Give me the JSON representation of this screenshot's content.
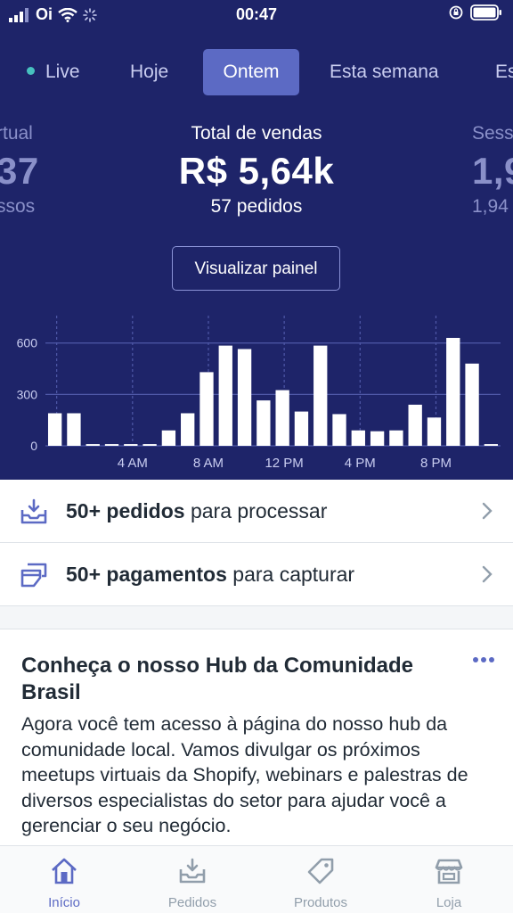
{
  "status_bar": {
    "carrier": "Oi",
    "time": "00:47"
  },
  "tabs": [
    {
      "label": "Live"
    },
    {
      "label": "Hoje"
    },
    {
      "label": "Ontem",
      "active": true
    },
    {
      "label": "Esta semana"
    },
    {
      "label": "Es"
    }
  ],
  "metrics": {
    "left": {
      "label": "rtual",
      "value": "37",
      "sub": "ssos"
    },
    "center": {
      "label": "Total de vendas",
      "value": "R$ 5,64k",
      "sub": "57 pedidos"
    },
    "right": {
      "label": "Sess",
      "value": "1,9",
      "sub": "1,94"
    }
  },
  "panel_button": "Visualizar painel",
  "chart_data": {
    "type": "bar",
    "y_ticks": [
      "0",
      "300",
      "600"
    ],
    "ylim": [
      0,
      760
    ],
    "x_tick_labels": [
      "4 AM",
      "8 AM",
      "12 PM",
      "4 PM",
      "8 PM"
    ],
    "x_tick_hours": [
      4,
      8,
      12,
      16,
      20
    ],
    "categories": [
      0,
      1,
      2,
      3,
      4,
      5,
      6,
      7,
      8,
      9,
      10,
      11,
      12,
      13,
      14,
      15,
      16,
      17,
      18,
      19,
      20,
      21,
      22,
      23
    ],
    "values": [
      190,
      190,
      10,
      10,
      10,
      10,
      90,
      190,
      430,
      585,
      565,
      265,
      325,
      200,
      585,
      185,
      90,
      85,
      90,
      240,
      165,
      630,
      480,
      10
    ],
    "colors": {
      "bar": "#ffffff",
      "grid": "#4f58a8",
      "tick": "#c9cdf0"
    }
  },
  "list": [
    {
      "bold": "50+ pedidos",
      "rest": " para processar",
      "icon": "inbox-download-icon"
    },
    {
      "bold": "50+ pagamentos",
      "rest": " para capturar",
      "icon": "payments-icon"
    }
  ],
  "card": {
    "title": "Conheça o nosso Hub da Comunidade Brasil",
    "body": "Agora você tem acesso à página do nosso hub da comunidade local. Vamos divulgar os próximos meetups virtuais da Shopify, webinars e palestras de diversos especialistas do setor para ajudar você a gerenciar o seu negócio."
  },
  "bottom_nav": [
    {
      "label": "Início",
      "icon": "home-icon",
      "active": true
    },
    {
      "label": "Pedidos",
      "icon": "orders-icon"
    },
    {
      "label": "Produtos",
      "icon": "tag-icon"
    },
    {
      "label": "Loja",
      "icon": "store-icon"
    }
  ],
  "colors": {
    "hero_bg": "#1e2469",
    "accent": "#5c6ac4",
    "text": "#212b36",
    "muted": "#919eab"
  }
}
